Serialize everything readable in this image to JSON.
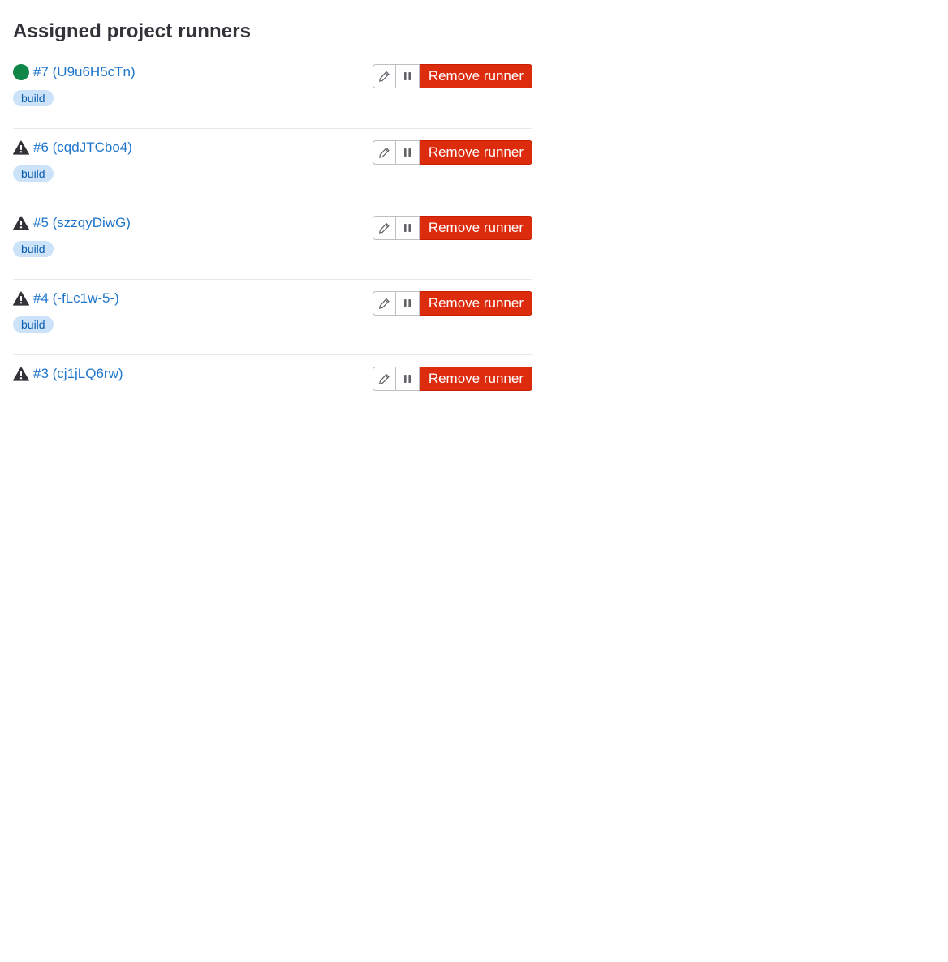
{
  "page": {
    "title": "Assigned project runners"
  },
  "colors": {
    "link": "#1f75cb",
    "online_status": "#108548",
    "tag_bg": "#cbe2f9",
    "tag_text": "#0b5cad",
    "danger": "#dd2b0e"
  },
  "runners": [
    {
      "label": "#7 (U9u6H5cTn)",
      "status": "online",
      "status_icon": "status-online-icon",
      "tag": "build",
      "remove_label": "Remove runner"
    },
    {
      "label": "#6 (cqdJTCbo4)",
      "status": "warning",
      "status_icon": "warning-icon",
      "tag": "build",
      "remove_label": "Remove runner"
    },
    {
      "label": "#5 (szzqyDiwG)",
      "status": "warning",
      "status_icon": "warning-icon",
      "tag": "build",
      "remove_label": "Remove runner"
    },
    {
      "label": "#4 (-fLc1w-5-)",
      "status": "warning",
      "status_icon": "warning-icon",
      "tag": "build",
      "remove_label": "Remove runner"
    },
    {
      "label": "#3 (cj1jLQ6rw)",
      "status": "warning",
      "status_icon": "warning-icon",
      "tag": "",
      "remove_label": "Remove runner"
    }
  ]
}
